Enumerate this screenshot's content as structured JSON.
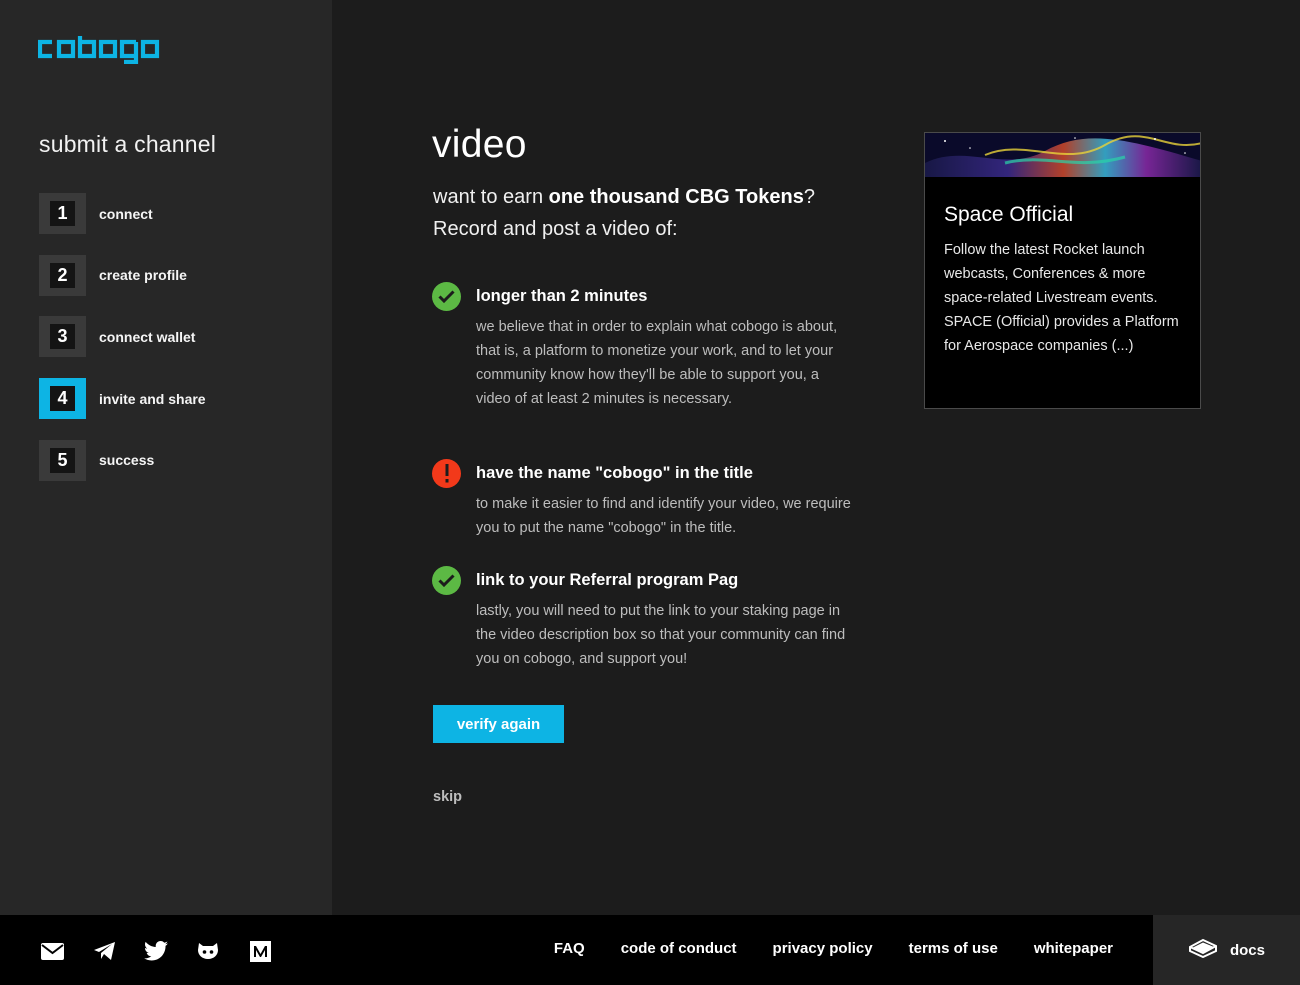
{
  "brand": {
    "logo_text": "cobogo",
    "accent": "#0db4e4"
  },
  "sidebar": {
    "title": "submit a channel",
    "steps": [
      {
        "num": "1",
        "label": "connect",
        "active": false
      },
      {
        "num": "2",
        "label": "create profile",
        "active": false
      },
      {
        "num": "3",
        "label": "connect wallet",
        "active": false
      },
      {
        "num": "4",
        "label": "invite and share",
        "active": true
      },
      {
        "num": "5",
        "label": "success",
        "active": false
      }
    ]
  },
  "main": {
    "heading": "video",
    "intro_prefix": "want to earn ",
    "intro_bold": "one thousand CBG Tokens",
    "intro_suffix": "?",
    "intro_line2": "Record and post a video of:",
    "requirements": [
      {
        "status": "ok",
        "title": "longer than 2 minutes",
        "desc": "we believe that in order to explain what cobogo is about, that is, a platform to monetize your work, and to let your community know how they'll be able to support you, a video of at least 2 minutes is necessary."
      },
      {
        "status": "error",
        "title": "have the name \"cobogo\" in the title",
        "desc": "to make it easier to find and identify your video, we require you to put the name \"cobogo\" in the title."
      },
      {
        "status": "ok",
        "title": "link to your Referral program Pag",
        "desc": "lastly, you will need to put the link to your staking page in the video description box so that your community can find you on cobogo, and support you!"
      }
    ],
    "verify_button": "verify again",
    "skip_link": "skip"
  },
  "channel_card": {
    "title": "Space Official",
    "description": "Follow the latest Rocket launch webcasts, Conferences & more space-related Livestream events. SPACE (Official) provides a Platform for Aerospace companies (...)"
  },
  "footer": {
    "social_icons": [
      "mail-icon",
      "telegram-icon",
      "twitter-icon",
      "github-icon",
      "medium-icon"
    ],
    "links": [
      "FAQ",
      "code of conduct",
      "privacy policy",
      "terms of use",
      "whitepaper"
    ],
    "docs_label": "docs"
  }
}
